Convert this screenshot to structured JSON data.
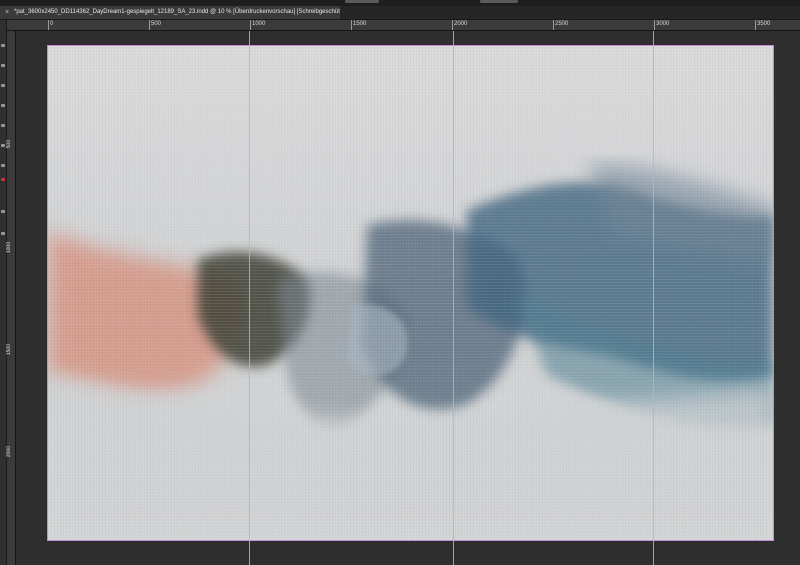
{
  "document": {
    "tab_title": "*pat_3600x2450_DD114362_DayDream1-gespiegelt_12189_SA_23.indd @ 10 % [Überdruckenvorschau] [Schreibgeschützt]",
    "close_glyph": "×"
  },
  "ruler": {
    "horizontal_labels": [
      "0",
      "500",
      "1000",
      "1500",
      "2000",
      "2500",
      "3000",
      "3500"
    ],
    "vertical_labels": [
      "500",
      "1000",
      "1500",
      "2000"
    ]
  },
  "canvas": {
    "frame_color": "#c58ad6",
    "guide_color": "#6fd3dc",
    "paper_color": "#d9d9da",
    "palette": {
      "coral": "#d9826b",
      "olive_dark": "#3c3f35",
      "slate": "#6f8496",
      "denim": "#3f6580",
      "petrol": "#4e7f92"
    }
  }
}
